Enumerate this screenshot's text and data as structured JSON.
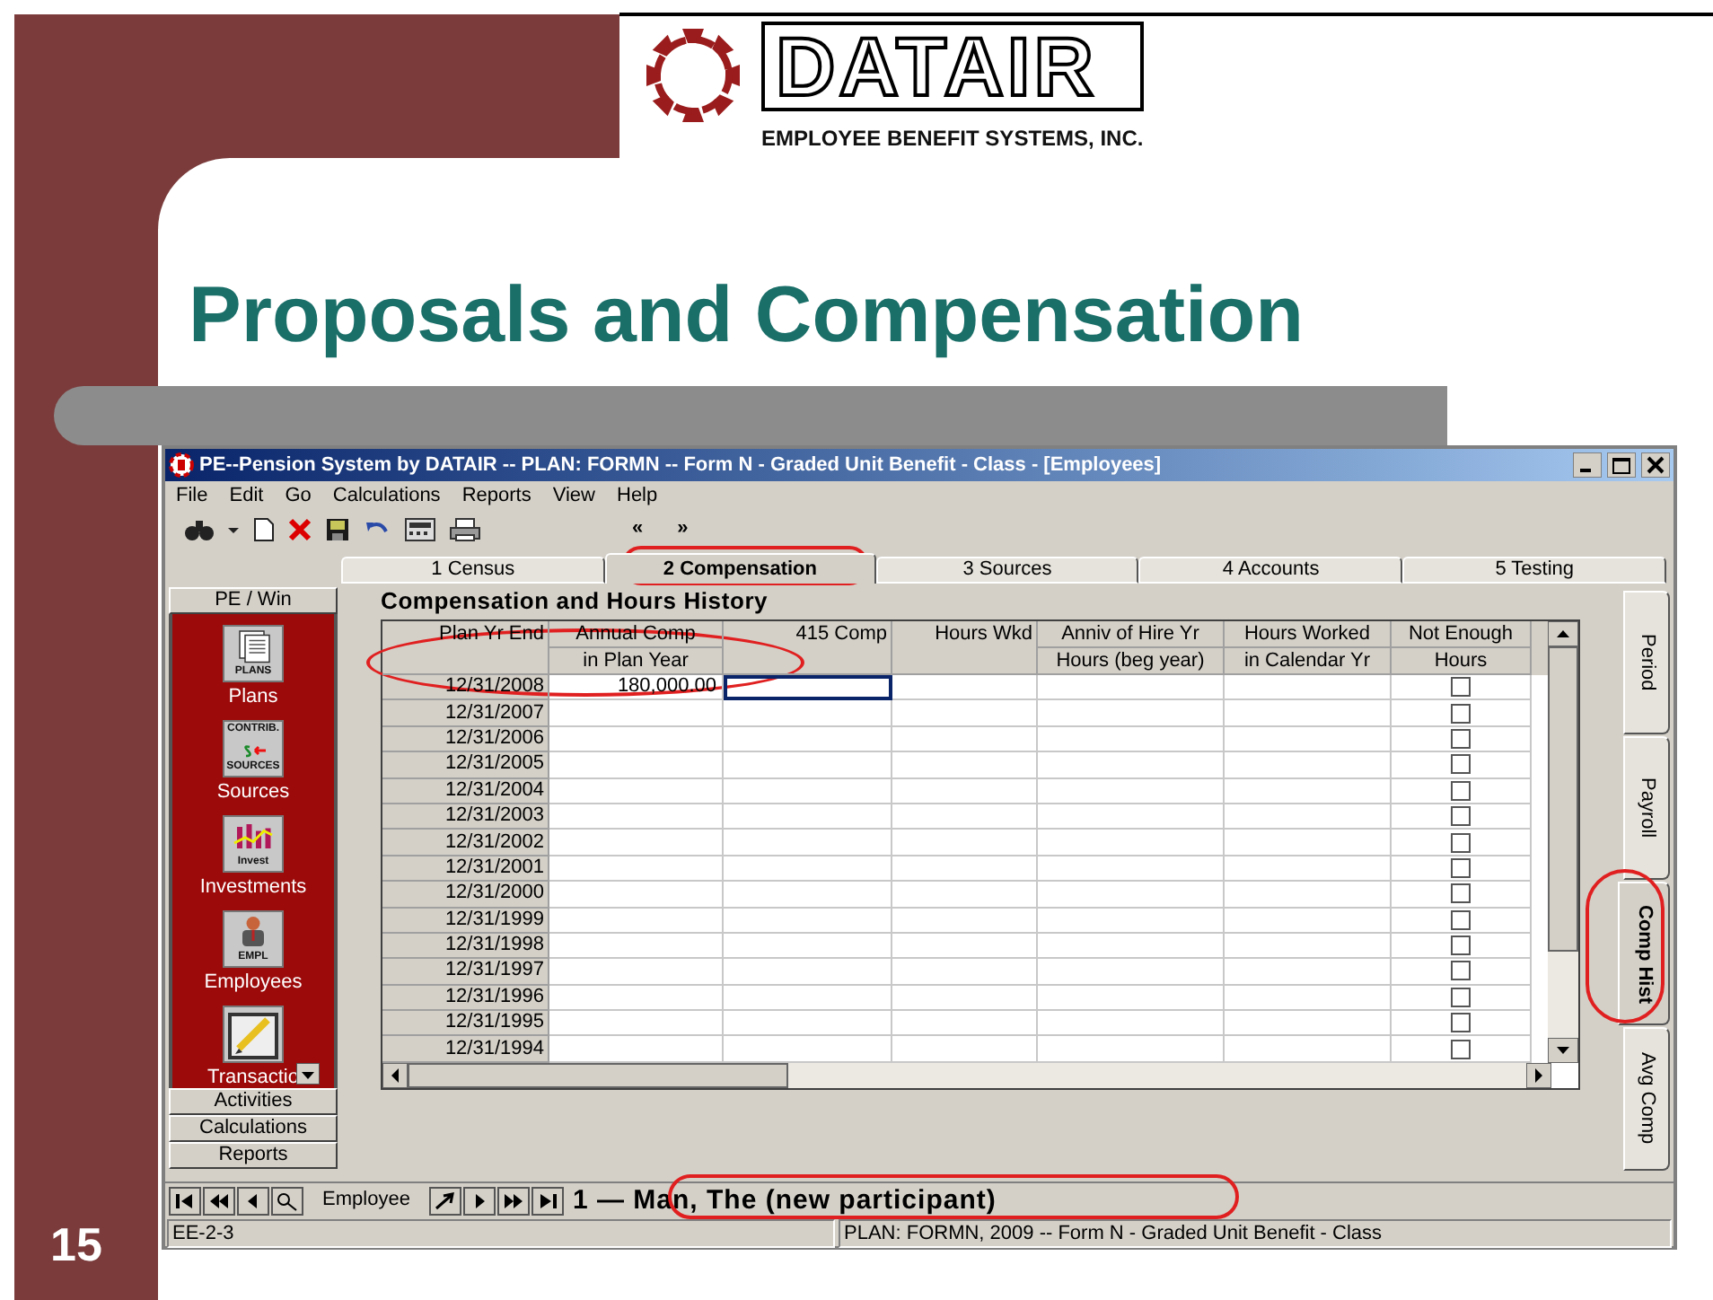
{
  "slide": {
    "logo": {
      "wordmark": "DATAIR",
      "tagline": "EMPLOYEE BENEFIT SYSTEMS, INC."
    },
    "title": "Proposals and Compensation",
    "page_number": "15"
  },
  "window": {
    "title": "PE--Pension System by DATAIR -- PLAN: FORMN -- Form N - Graded Unit Benefit - Class - [Employees]"
  },
  "menu": [
    "File",
    "Edit",
    "Go",
    "Calculations",
    "Reports",
    "View",
    "Help"
  ],
  "toolbar": {
    "back": "«",
    "forward": "»"
  },
  "tabs": [
    {
      "label": "1 Census",
      "selected": false
    },
    {
      "label": "2 Compensation",
      "selected": true
    },
    {
      "label": "3 Sources",
      "selected": false
    },
    {
      "label": "4 Accounts",
      "selected": false
    },
    {
      "label": "5 Testing",
      "selected": false
    }
  ],
  "sidebar": {
    "header": "PE / Win",
    "items": [
      {
        "label": "Plans",
        "kind": "plans",
        "icon_texts": [
          "PLANS"
        ]
      },
      {
        "label": "Sources",
        "kind": "sources",
        "icon_texts": [
          "CONTRIB.",
          "SOURCES"
        ]
      },
      {
        "label": "Investments",
        "kind": "invest",
        "icon_texts": [
          "Invest"
        ]
      },
      {
        "label": "Employees",
        "kind": "employee",
        "icon_texts": [
          "EMPL"
        ]
      },
      {
        "label": "Transactio",
        "kind": "transactions"
      }
    ],
    "buttons": [
      "Activities",
      "Calculations",
      "Reports"
    ]
  },
  "grid": {
    "heading": "Compensation and Hours History",
    "columns": [
      {
        "line1": "Plan Yr End"
      },
      {
        "line1": "Annual Comp",
        "line2": "in Plan Year"
      },
      {
        "line1": "415 Comp"
      },
      {
        "line1": "Hours Wkd"
      },
      {
        "line1": "Anniv of Hire Yr",
        "line2": "Hours (beg year)"
      },
      {
        "line1": "Hours Worked",
        "line2": "in Calendar Yr"
      },
      {
        "line1": "Not Enough",
        "line2": "Hours"
      }
    ],
    "rows": [
      {
        "plan_yr_end": "12/31/2008",
        "annual_comp": "180,000.00",
        "not_enough_hours": false,
        "selected": true
      },
      {
        "plan_yr_end": "12/31/2007",
        "not_enough_hours": false,
        "selected": false
      },
      {
        "plan_yr_end": "12/31/2006",
        "not_enough_hours": false,
        "selected": false
      },
      {
        "plan_yr_end": "12/31/2005",
        "not_enough_hours": false,
        "selected": false
      },
      {
        "plan_yr_end": "12/31/2004",
        "not_enough_hours": false,
        "selected": false
      },
      {
        "plan_yr_end": "12/31/2003",
        "not_enough_hours": false,
        "selected": false
      },
      {
        "plan_yr_end": "12/31/2002",
        "not_enough_hours": false,
        "selected": false
      },
      {
        "plan_yr_end": "12/31/2001",
        "not_enough_hours": false,
        "selected": false
      },
      {
        "plan_yr_end": "12/31/2000",
        "not_enough_hours": false,
        "selected": false
      },
      {
        "plan_yr_end": "12/31/1999",
        "not_enough_hours": false,
        "selected": false
      },
      {
        "plan_yr_end": "12/31/1998",
        "not_enough_hours": false,
        "selected": false
      },
      {
        "plan_yr_end": "12/31/1997",
        "not_enough_hours": false,
        "selected": false
      },
      {
        "plan_yr_end": "12/31/1996",
        "not_enough_hours": false,
        "selected": false
      },
      {
        "plan_yr_end": "12/31/1995",
        "not_enough_hours": false,
        "selected": false
      },
      {
        "plan_yr_end": "12/31/1994",
        "not_enough_hours": false,
        "selected": false
      }
    ]
  },
  "side_tabs": [
    {
      "label": "Period",
      "selected": false
    },
    {
      "label": "Payroll",
      "selected": false
    },
    {
      "label": "Comp Hist",
      "selected": true
    },
    {
      "label": "Avg Comp",
      "selected": false
    }
  ],
  "record_nav": {
    "label": "Employee",
    "current": "1 — Man, The (new participant)"
  },
  "status_bar": [
    "EE-2-3",
    "PLAN: FORMN,  2009 -- Form N - Graded Unit Benefit - Class"
  ]
}
